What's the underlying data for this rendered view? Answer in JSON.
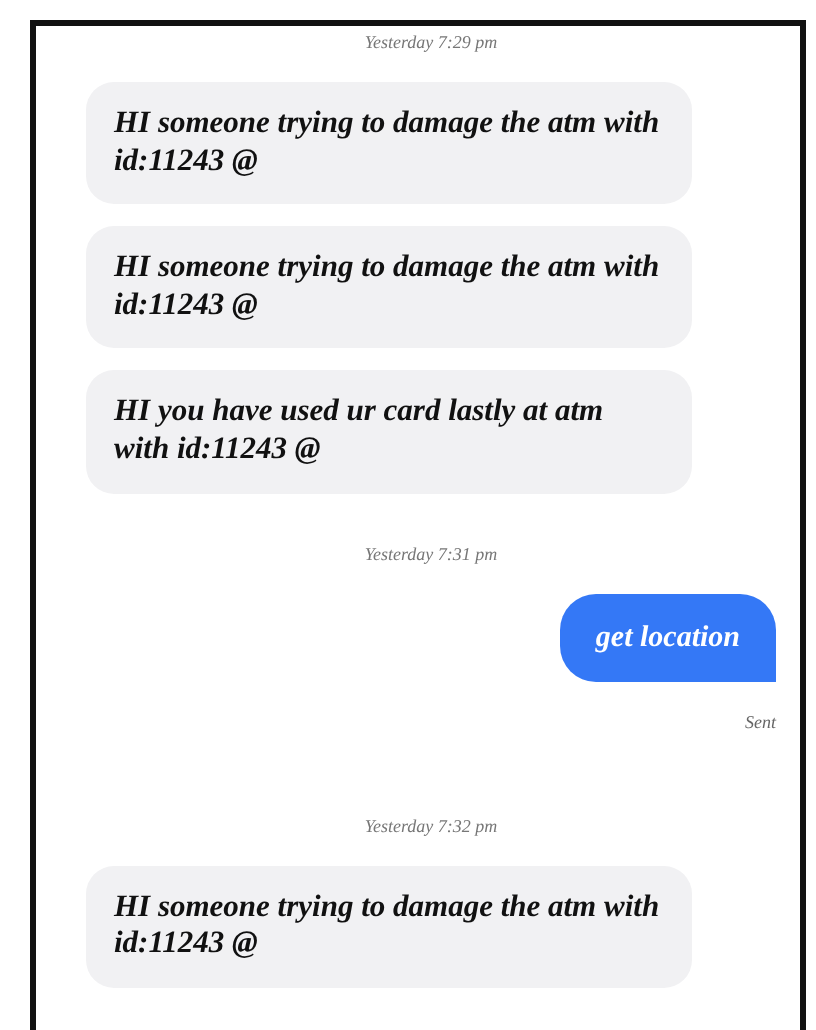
{
  "messages": [
    {
      "kind": "timestamp",
      "text": "Yesterday 7:29 pm"
    },
    {
      "kind": "incoming",
      "text": "HI someone trying to damage the atm with id:11243 @"
    },
    {
      "kind": "incoming",
      "text": "HI someone trying to damage the atm with id:11243 @"
    },
    {
      "kind": "incoming",
      "text": "HI you have used ur card lastly at atm with id:11243 @"
    },
    {
      "kind": "timestamp",
      "text": "Yesterday 7:31 pm"
    },
    {
      "kind": "outgoing",
      "text": "get location"
    },
    {
      "kind": "status",
      "text": "Sent"
    },
    {
      "kind": "timestamp",
      "text": "Yesterday 7:32 pm"
    },
    {
      "kind": "incoming",
      "text": "HI someone trying to damage the atm with id:11243 @"
    }
  ]
}
